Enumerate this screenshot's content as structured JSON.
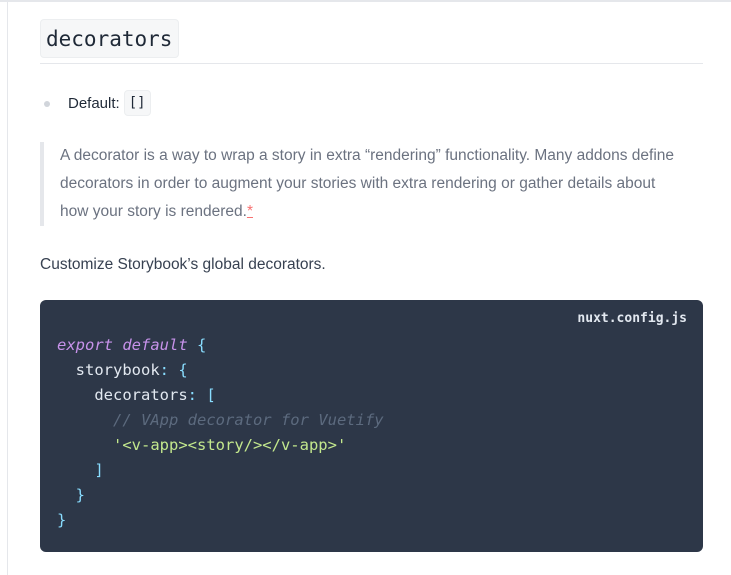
{
  "heading": {
    "code": "decorators"
  },
  "option": {
    "label": "Default:",
    "value": "[]"
  },
  "quote": {
    "text": "A decorator is a way to wrap a story in extra “rendering” functionality. Many addons define decorators in order to augment your stories with extra rendering or gather details about how your story is rendered.",
    "asterisk": "*"
  },
  "paragraph": "Customize Storybook’s global decorators.",
  "code": {
    "filename": "nuxt.config.js",
    "line1_kw": "export default",
    "line1_punc": " {",
    "line2_indent": "  ",
    "line2_prop": "storybook",
    "line2_punc": ": {",
    "line3_indent": "    ",
    "line3_prop": "decorators",
    "line3_punc": ": [",
    "line4_indent": "      ",
    "line4_comment": "// VApp decorator for Vuetify",
    "line5_indent": "      ",
    "line5_str": "'<v-app><story/></v-app>'",
    "line6_indent": "    ",
    "line6_punc": "]",
    "line7_indent": "  ",
    "line7_punc": "}",
    "line8_punc": "}"
  },
  "colors": {
    "code_background": "#2d3748",
    "keyword": "#c792ea",
    "punctuation": "#89ddff",
    "string": "#c3e88d",
    "comment": "#5c6a7e",
    "asterisk": "#f87171"
  }
}
